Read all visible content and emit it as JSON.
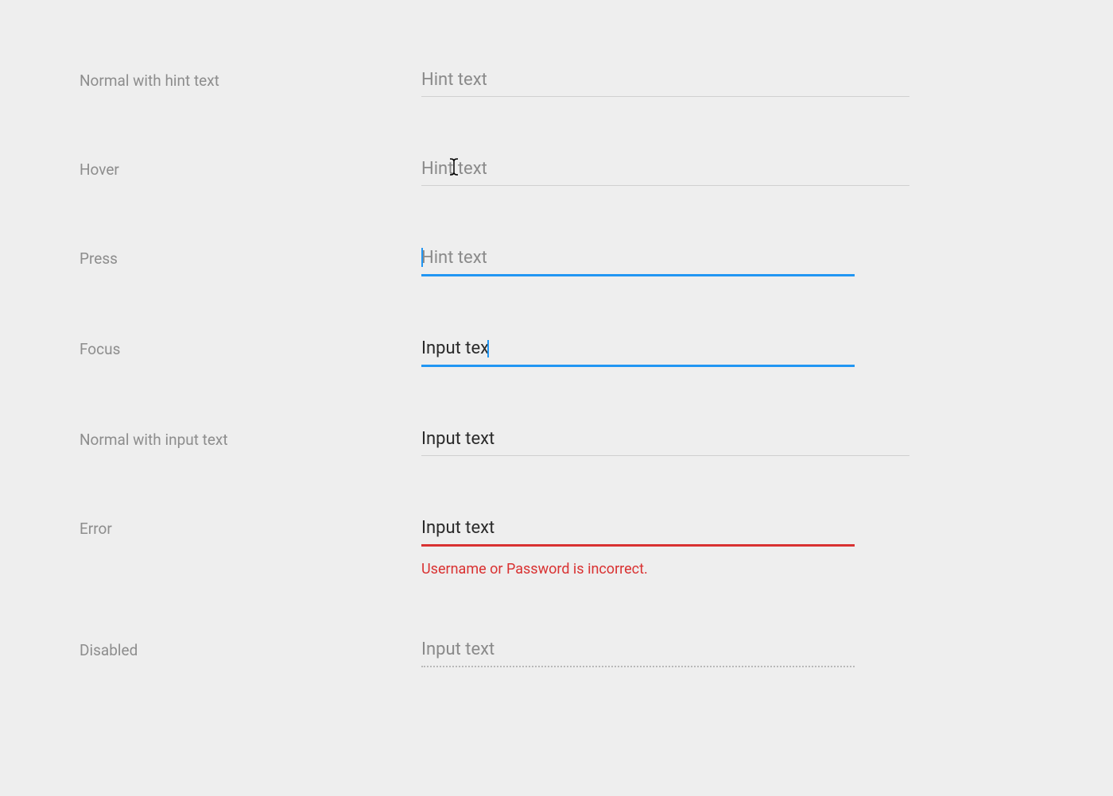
{
  "states": {
    "normal_hint": {
      "label": "Normal with hint text",
      "placeholder": "Hint text",
      "value": ""
    },
    "hover": {
      "label": "Hover",
      "placeholder": "Hint text",
      "value": ""
    },
    "press": {
      "label": "Press",
      "placeholder": "Hint text",
      "value": ""
    },
    "focus": {
      "label": "Focus",
      "value": "Input tex"
    },
    "normal_input": {
      "label": "Normal with input text",
      "value": "Input text"
    },
    "error": {
      "label": "Error",
      "value": "Input text",
      "message": "Username or Password is incorrect."
    },
    "disabled": {
      "label": "Disabled",
      "value": "Input text"
    }
  }
}
